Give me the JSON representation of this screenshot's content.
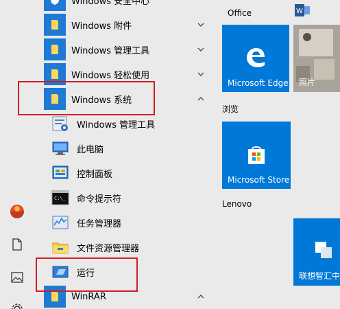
{
  "list": {
    "top_partial": "Windows 安全中心",
    "folders": [
      {
        "label": "Windows 附件",
        "state": "collapsed"
      },
      {
        "label": "Windows 管理工具",
        "state": "collapsed"
      },
      {
        "label": "Windows 轻松使用",
        "state": "collapsed"
      },
      {
        "label": "Windows 系统",
        "state": "expanded"
      }
    ],
    "system_items": [
      {
        "label": "Windows 管理工具",
        "icon": "admin-tools-icon"
      },
      {
        "label": "此电脑",
        "icon": "computer-icon"
      },
      {
        "label": "控制面板",
        "icon": "control-panel-icon"
      },
      {
        "label": "命令提示符",
        "icon": "cmd-icon"
      },
      {
        "label": "任务管理器",
        "icon": "task-manager-icon"
      },
      {
        "label": "文件资源管理器",
        "icon": "explorer-icon"
      },
      {
        "label": "运行",
        "icon": "run-icon"
      }
    ],
    "winrar": {
      "label": "WinRAR",
      "state": "expanded"
    }
  },
  "tiles": {
    "office_label": "Office",
    "edge_label": "Microsoft Edge",
    "photos_label": "照片",
    "browse_group": "浏览",
    "store_label": "Microsoft Store",
    "lenovo_group": "Lenovo",
    "lenovo_label": "联想智汇中"
  },
  "colors": {
    "accent": "#0078d7",
    "highlight": "#d01c24",
    "background": "#eaeaea"
  }
}
